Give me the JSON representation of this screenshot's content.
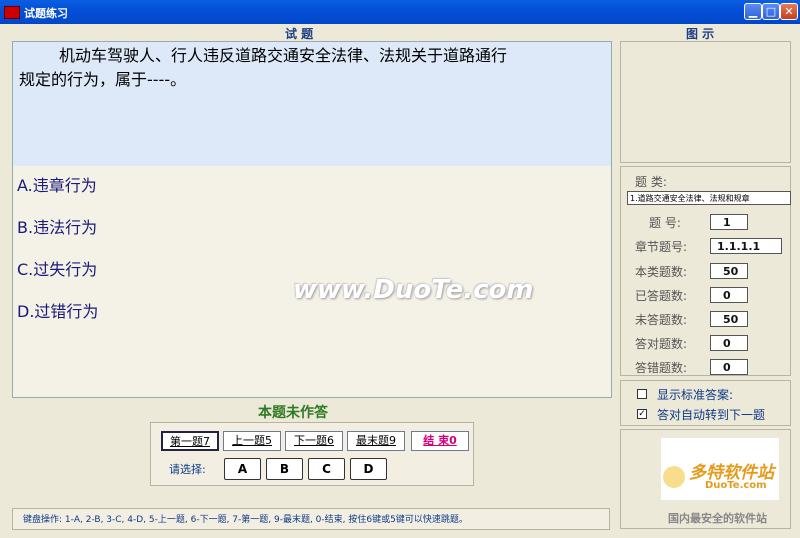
{
  "window": {
    "title": "试题练习"
  },
  "question": {
    "section_label": "试  题",
    "text_line1": "机动车驾驶人、行人违反道路交通安全法律、法规关于道路通行",
    "text_line2": "规定的行为，属于----。",
    "options": [
      "A.违章行为",
      "B.违法行为",
      "C.过失行为",
      "D.过错行为"
    ]
  },
  "status_text": "本题未作答",
  "nav": {
    "first": "第一题7",
    "prev": "上一题5",
    "next": "下一题6",
    "last": "最末题9",
    "end": "结  束0"
  },
  "choose": {
    "label": "请选择:",
    "answers": [
      "A",
      "B",
      "C",
      "D"
    ]
  },
  "hint": "键盘操作: 1-A, 2-B, 3-C, 4-D, 5-上一题, 6-下一题, 7-第一题, 9-最末题, 0-结束, 按住6键或5键可以快速跳题。",
  "figure": {
    "label": "图  示"
  },
  "info": {
    "category_label": "题  类:",
    "category_value": "1.道路交通安全法律、法规和规章",
    "rows": [
      {
        "label": "题   号:",
        "value": "1"
      },
      {
        "label": "章节题号:",
        "value": "1.1.1.1"
      },
      {
        "label": "本类题数:",
        "value": "50"
      },
      {
        "label": "已答题数:",
        "value": "0"
      },
      {
        "label": "未答题数:",
        "value": "50"
      },
      {
        "label": "答对题数:",
        "value": "0"
      },
      {
        "label": "答错题数:",
        "value": "0"
      }
    ]
  },
  "options_panel": {
    "show_answer": {
      "label": "显示标准答案:",
      "checked": false
    },
    "auto_next": {
      "label": "答对自动转到下一题",
      "checked": true
    }
  },
  "watermark": "www.DuoTe.com",
  "logo": {
    "name": "多特软件站",
    "site": "DuoTe.com",
    "slogan": "国内最安全的软件站"
  },
  "colors": {
    "titlebar": "#0450D8",
    "question_bg": "#DDE8F8",
    "status": "#2f7a22",
    "end_button": "#d1007a"
  }
}
